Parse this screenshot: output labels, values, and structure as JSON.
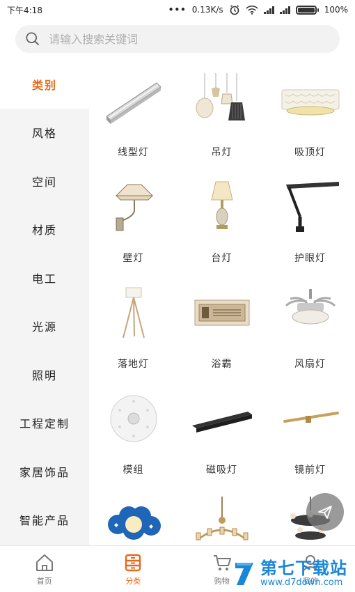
{
  "status_bar": {
    "time": "下午4:18",
    "dots": "•••",
    "speed": "0.13K/s",
    "battery": "100%",
    "icons": [
      "alarm-icon",
      "wifi-icon",
      "signal-icon",
      "signal-icon",
      "battery-icon"
    ]
  },
  "search": {
    "placeholder": "请输入搜索关键词",
    "value": ""
  },
  "sidebar": {
    "items": [
      {
        "label": "类别",
        "active": true
      },
      {
        "label": "风格"
      },
      {
        "label": "空间"
      },
      {
        "label": "材质"
      },
      {
        "label": "电工"
      },
      {
        "label": "光源"
      },
      {
        "label": "照明"
      },
      {
        "label": "工程定制"
      },
      {
        "label": "家居饰品"
      },
      {
        "label": "智能产品"
      }
    ]
  },
  "grid": {
    "items": [
      {
        "label": "线型灯",
        "icon": "linear-light-icon"
      },
      {
        "label": "吊灯",
        "icon": "pendant-light-icon"
      },
      {
        "label": "吸顶灯",
        "icon": "ceiling-light-icon"
      },
      {
        "label": "壁灯",
        "icon": "wall-lamp-icon"
      },
      {
        "label": "台灯",
        "icon": "table-lamp-icon"
      },
      {
        "label": "护眼灯",
        "icon": "desk-lamp-icon"
      },
      {
        "label": "落地灯",
        "icon": "floor-lamp-icon"
      },
      {
        "label": "浴霸",
        "icon": "bath-heater-icon"
      },
      {
        "label": "风扇灯",
        "icon": "fan-light-icon"
      },
      {
        "label": "模组",
        "icon": "led-module-icon"
      },
      {
        "label": "磁吸灯",
        "icon": "magnetic-track-icon"
      },
      {
        "label": "镜前灯",
        "icon": "mirror-light-icon"
      },
      {
        "label": "",
        "icon": "kids-lamp-icon"
      },
      {
        "label": "",
        "icon": "chandelier-icon"
      },
      {
        "label": "",
        "icon": "crystal-chandelier-icon"
      }
    ]
  },
  "bottom_nav": {
    "tabs": [
      {
        "label": "首页",
        "icon": "home-icon"
      },
      {
        "label": "分类",
        "icon": "category-icon",
        "active": true
      },
      {
        "label": "购物",
        "icon": "cart-icon"
      },
      {
        "label": "我的",
        "icon": "profile-icon"
      }
    ]
  },
  "watermark": {
    "title": "第七下载站",
    "url": "www.d7down.com"
  },
  "colors": {
    "accent": "#e8691a",
    "sidebar_bg": "#f4f4f4",
    "watermark": "#1a86d8"
  }
}
